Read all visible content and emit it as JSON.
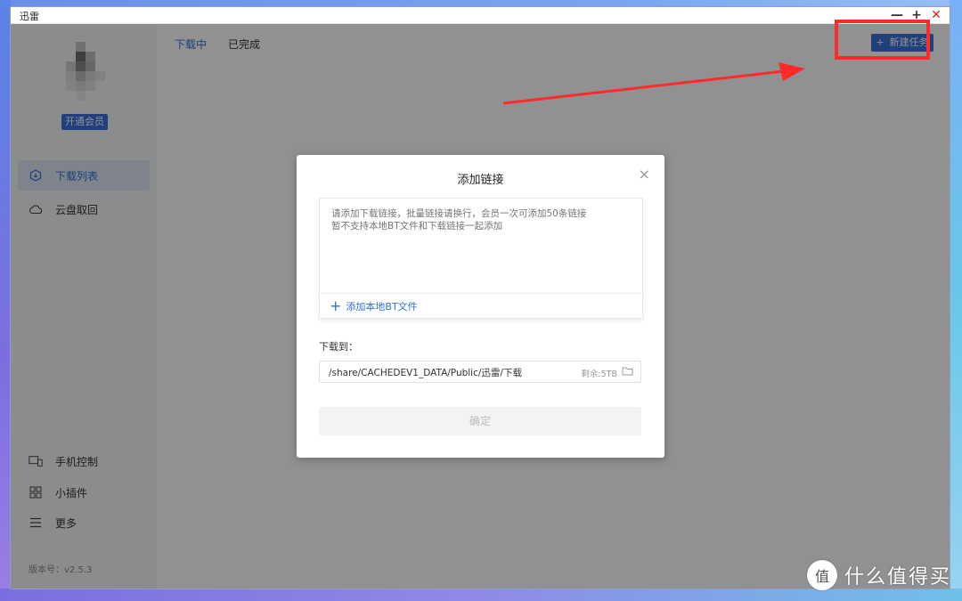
{
  "window": {
    "title": "迅雷",
    "minimize": "—",
    "maximize": "+",
    "close": "✕"
  },
  "sidebar": {
    "vip_button": "开通会员",
    "nav_top": [
      {
        "label": "下载列表",
        "icon": "download-list-icon",
        "active": true
      },
      {
        "label": "云盘取回",
        "icon": "cloud-icon",
        "active": false
      }
    ],
    "nav_bottom": [
      {
        "label": "手机控制",
        "icon": "devices-icon"
      },
      {
        "label": "小插件",
        "icon": "grid-icon"
      },
      {
        "label": "更多",
        "icon": "menu-icon"
      }
    ],
    "version": "版本号：v2.5.3"
  },
  "main": {
    "tabs": [
      {
        "label": "下载中",
        "active": true
      },
      {
        "label": "已完成",
        "active": false
      }
    ],
    "new_task": {
      "plus": "+",
      "label": "新建任务"
    }
  },
  "dialog": {
    "title": "添加链接",
    "close": "×",
    "link_placeholder": "请添加下载链接，批量链接请换行，会员一次可添加50条链接\n暂不支持本地BT文件和下载链接一起添加",
    "add_bt": {
      "plus": "+",
      "label": "添加本地BT文件"
    },
    "download_to_label": "下载到：",
    "path": "/share/CACHEDEV1_DATA/Public/迅雷/下载",
    "free_space": "剩余:5TB",
    "confirm": "确定"
  },
  "watermark": {
    "circle": "值",
    "text": "什么值得买"
  },
  "colors": {
    "accent": "#3a6fd8",
    "highlight": "#ff2a2a",
    "close_red": "#e02020"
  }
}
